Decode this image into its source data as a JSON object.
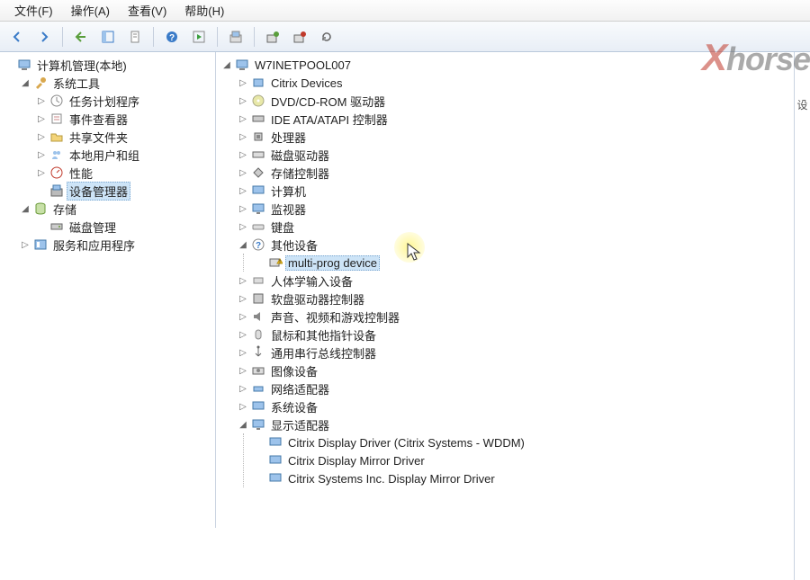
{
  "menu": {
    "file": "文件(F)",
    "action": "操作(A)",
    "view": "查看(V)",
    "help": "帮助(H)"
  },
  "watermark_text": "horse",
  "side_tab": "设",
  "left_tree": {
    "root": "计算机管理(本地)",
    "sys_tools": "系统工具",
    "task_scheduler": "任务计划程序",
    "event_viewer": "事件查看器",
    "shared_folders": "共享文件夹",
    "local_users": "本地用户和组",
    "performance": "性能",
    "device_manager": "设备管理器",
    "storage": "存储",
    "disk_mgmt": "磁盘管理",
    "services_apps": "服务和应用程序"
  },
  "right_tree": {
    "root": "W7INETPOOL007",
    "citrix_devices": "Citrix Devices",
    "dvd": "DVD/CD-ROM 驱动器",
    "ide": "IDE ATA/ATAPI 控制器",
    "cpu": "处理器",
    "disk_drives": "磁盘驱动器",
    "storage_ctrl": "存储控制器",
    "computer": "计算机",
    "monitors": "监视器",
    "keyboards": "键盘",
    "other_devices": "其他设备",
    "multi_prog": "multi-prog device",
    "hid": "人体学输入设备",
    "floppy_ctrl": "软盘驱动器控制器",
    "sound": "声音、视频和游戏控制器",
    "mouse": "鼠标和其他指针设备",
    "usb_ctrl": "通用串行总线控制器",
    "imaging": "图像设备",
    "network": "网络适配器",
    "system_devices": "系统设备",
    "display": "显示适配器",
    "display_child1": "Citrix Display Driver (Citrix Systems - WDDM)",
    "display_child2": "Citrix Display Mirror Driver",
    "display_child3": "Citrix Systems Inc. Display Mirror Driver"
  }
}
